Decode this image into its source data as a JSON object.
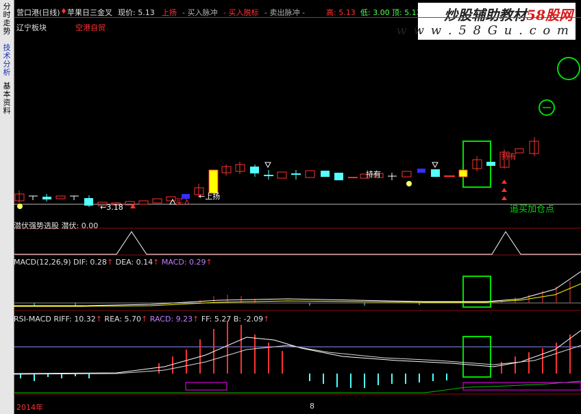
{
  "sidebar": {
    "tabs": [
      {
        "label": "分时走势"
      },
      {
        "label": "技术分析"
      },
      {
        "label": "基本资料"
      }
    ]
  },
  "header": {
    "stock": "营口港(日线)",
    "formula": "苹果日三金叉",
    "price_label": "现价: 5.13",
    "signals": [
      "上扬",
      "买入脉冲",
      "买入脱标",
      "卖出脉冲"
    ],
    "high": "高: 5.13",
    "low": "低: 3.00",
    "close": "顶: 5.13",
    "sector": "辽宁板块",
    "tag": "空港自贸"
  },
  "watermark": {
    "line1_a": "炒股辅助教材",
    "line1_b": "58股网",
    "line2": "w w w . 5 8 G u . c o m"
  },
  "main_chart": {
    "annotations": {
      "low_price": "←3.18",
      "buy": "买入",
      "rise": "上扬",
      "hold": "持有",
      "top_hold": "持有",
      "add_point": "追买加仓点"
    }
  },
  "panel1": {
    "title": "潜伏强势选股",
    "value": "潜伏: 0.00"
  },
  "panel2": {
    "title": "MACD(12,26,9)",
    "dif": "DIF: 0.28",
    "dea": "DEA: 0.14",
    "macd": "MACD: 0.29"
  },
  "panel3": {
    "title": "RSI-MACD",
    "riff": "RIFF: 10.32",
    "rea": "REA: 5.70",
    "racd": "RACD: 9.23",
    "ff": "FF: 5.27",
    "b": "B: -2.09"
  },
  "footer": {
    "year": "2014年",
    "marker": "8"
  },
  "colors": {
    "up": "#ff3232",
    "down": "#54ffff",
    "highlight_box": "#00e000",
    "white_line": "#ffffff",
    "magenta": "#ff00ff",
    "yellow": "#ffff00"
  }
}
